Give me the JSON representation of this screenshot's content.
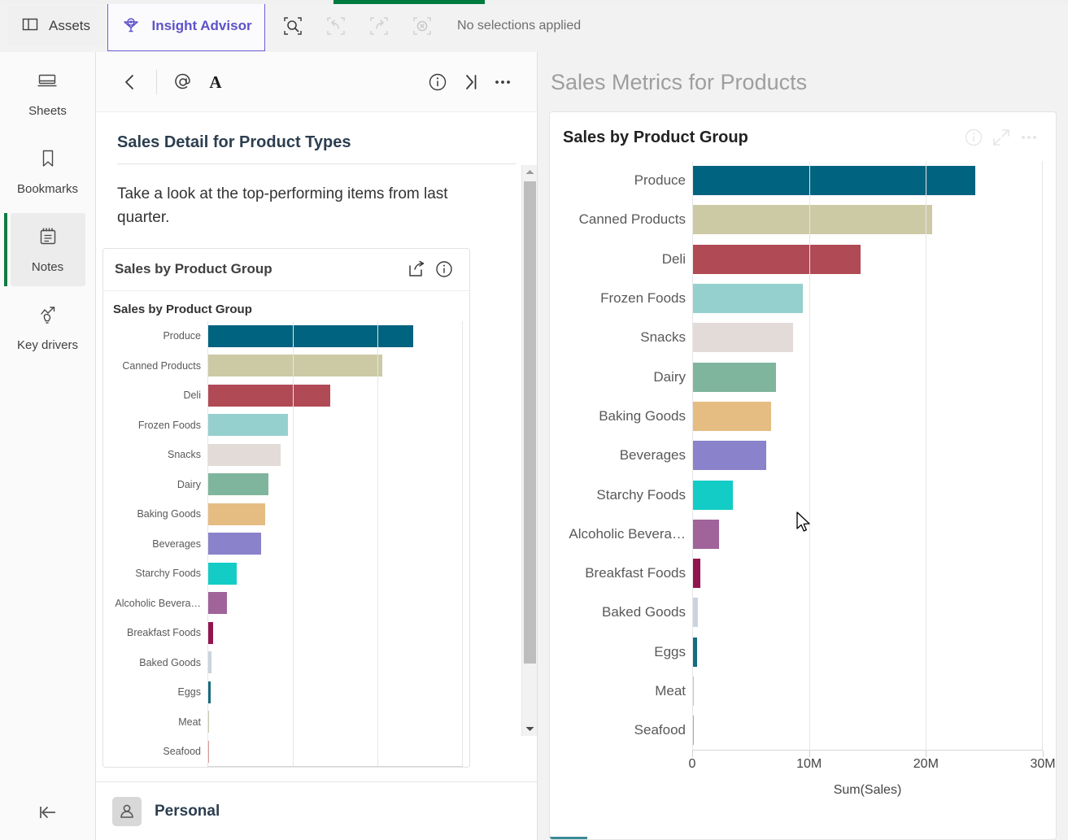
{
  "window": {
    "progress_percent": 14
  },
  "topbar": {
    "assets_label": "Assets",
    "assets_icon": "panel-icon",
    "insight_advisor_label": "Insight Advisor",
    "insight_advisor_icon": "insight-bulb-icon",
    "selection_search_icon": "selection-search-icon",
    "undo_icon": "undo-icon",
    "redo_icon": "redo-icon",
    "clear_selections_icon": "clear-selections-icon",
    "selections_text": "No selections applied"
  },
  "rail": {
    "items": [
      {
        "label": "Sheets",
        "icon": "sheets-icon",
        "active": false
      },
      {
        "label": "Bookmarks",
        "icon": "bookmark-icon",
        "active": false
      },
      {
        "label": "Notes",
        "icon": "notes-icon",
        "active": true
      },
      {
        "label": "Key drivers",
        "icon": "key-drivers-icon",
        "active": false
      }
    ],
    "collapse_icon": "collapse-left-icon"
  },
  "notes_panel": {
    "toolbar": {
      "back_icon": "chevron-left-icon",
      "mention_icon": "at-icon",
      "text_format_icon": "text-format-icon",
      "info_icon": "info-circle-icon",
      "collapse_icon": "collapse-right-icon",
      "more_icon": "ellipsis-icon"
    },
    "title": "Sales Detail for Product Types",
    "body_text": "Take a look at the top-performing items from last quarter.",
    "embedded_card": {
      "title": "Sales by Product Group",
      "share_icon": "share-export-icon",
      "info_icon": "info-circle-icon",
      "chart_title": "Sales by Product Group"
    },
    "footer": {
      "avatar_icon": "user-avatar-icon",
      "name": "Personal"
    }
  },
  "right_panel": {
    "title": "Sales Metrics for Products",
    "card": {
      "title": "Sales by Product Group",
      "info_icon": "info-circle-icon",
      "fullscreen_icon": "expand-icon",
      "more_icon": "ellipsis-icon"
    }
  },
  "chart_data": {
    "type": "bar",
    "orientation": "horizontal",
    "title": "Sales by Product Group",
    "xlabel": "Sum(Sales)",
    "ylabel": "",
    "xlim": [
      0,
      30000000
    ],
    "xticks": [
      0,
      10000000,
      20000000,
      30000000
    ],
    "xtick_labels": [
      "0",
      "10M",
      "20M",
      "30M"
    ],
    "grid": true,
    "legend": "none",
    "categories": [
      "Produce",
      "Canned Products",
      "Deli",
      "Frozen Foods",
      "Snacks",
      "Dairy",
      "Baking Goods",
      "Beverages",
      "Starchy Foods",
      "Alcoholic Bevera…",
      "Breakfast Foods",
      "Baked Goods",
      "Eggs",
      "Meat",
      "Seafood"
    ],
    "values": [
      24200000,
      20500000,
      14400000,
      9500000,
      8600000,
      7150000,
      6750000,
      6350000,
      3450000,
      2300000,
      700000,
      500000,
      400000,
      110000,
      110000
    ],
    "colors": [
      "#00637f",
      "#ccc9a5",
      "#b04a55",
      "#96d0ce",
      "#e2dbd7",
      "#7fb59c",
      "#e5bd83",
      "#8a82cb",
      "#13ccc6",
      "#a0639a",
      "#92154f",
      "#cbd4de",
      "#176b7f",
      "#c9c9b0",
      "#d99a9a"
    ]
  }
}
